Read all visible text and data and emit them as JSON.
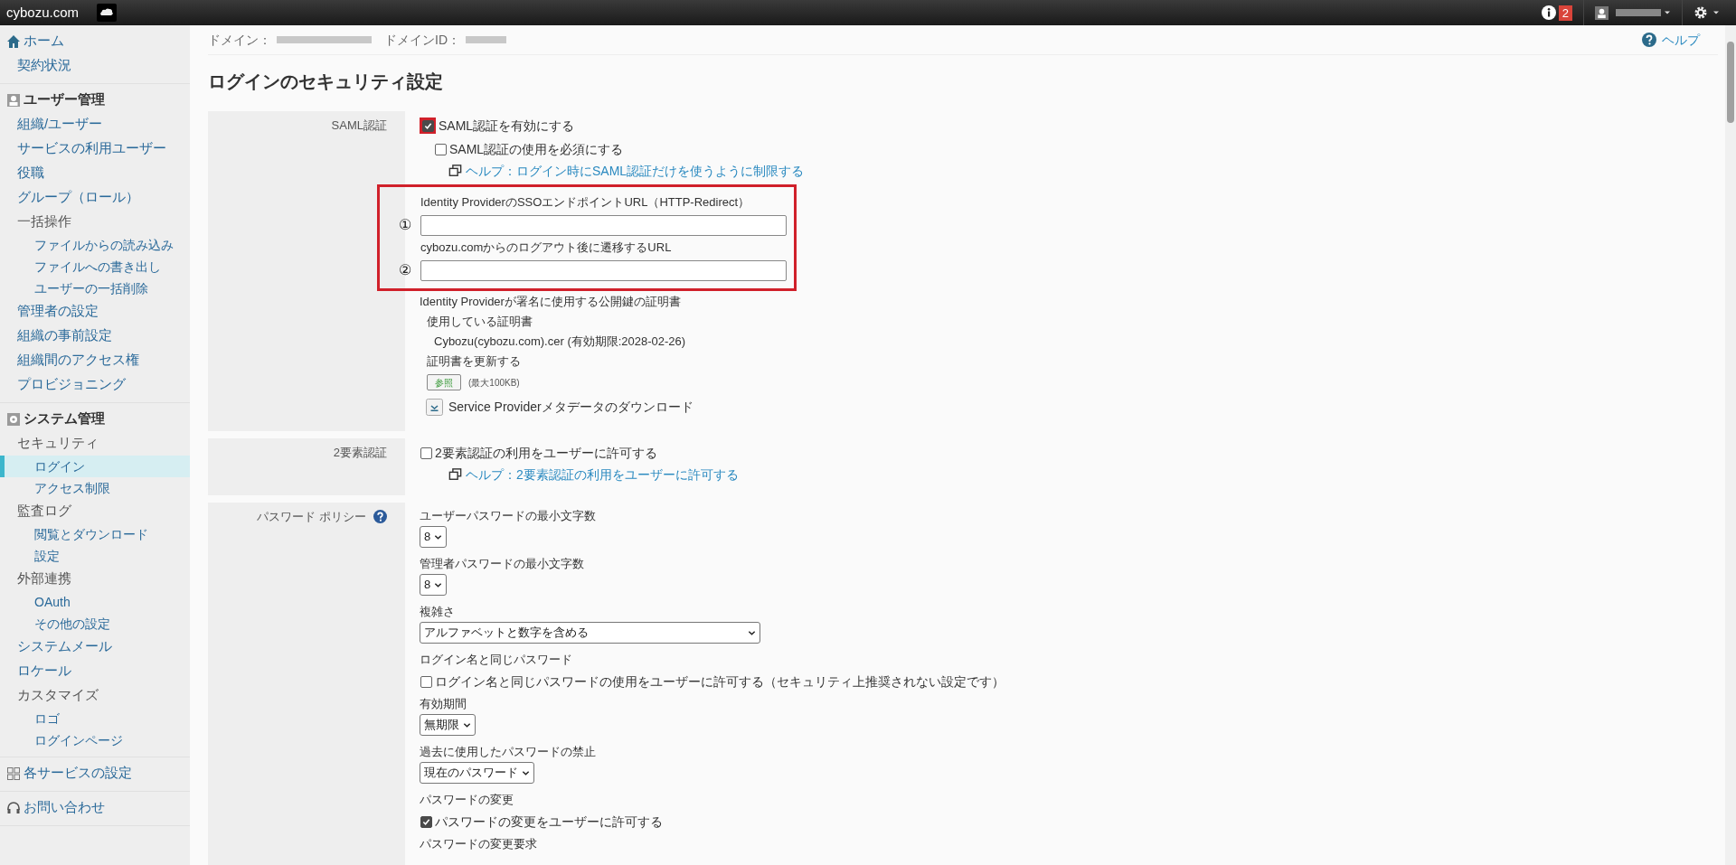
{
  "topbar": {
    "brand": "cybozu.com",
    "notifications": "2"
  },
  "sidebar": [
    {
      "kind": "home",
      "label": "ホーム",
      "children": [
        {
          "label": "契約状況",
          "selected": false
        }
      ]
    },
    {
      "kind": "user",
      "label": "ユーザー管理",
      "children": [
        {
          "label": "組織/ユーザー",
          "selected": false
        },
        {
          "label": "サービスの利用ユーザー",
          "selected": false
        },
        {
          "label": "役職",
          "selected": false
        },
        {
          "label": "グループ（ロール）",
          "selected": false
        },
        {
          "label": "一括操作",
          "selected": false,
          "children": [
            {
              "label": "ファイルからの読み込み",
              "selected": false
            },
            {
              "label": "ファイルへの書き出し",
              "selected": false
            },
            {
              "label": "ユーザーの一括削除",
              "selected": false
            }
          ]
        },
        {
          "label": "管理者の設定",
          "selected": false
        },
        {
          "label": "組織の事前設定",
          "selected": false
        },
        {
          "label": "組織間のアクセス権",
          "selected": false
        },
        {
          "label": "プロビジョニング",
          "selected": false
        }
      ]
    },
    {
      "kind": "gear",
      "label": "システム管理",
      "children": [
        {
          "label": "セキュリティ",
          "selected": false,
          "children": [
            {
              "label": "ログイン",
              "selected": true
            },
            {
              "label": "アクセス制限",
              "selected": false
            }
          ]
        },
        {
          "label": "監査ログ",
          "selected": false,
          "children": [
            {
              "label": "閲覧とダウンロード",
              "selected": false
            },
            {
              "label": "設定",
              "selected": false
            }
          ]
        },
        {
          "label": "外部連携",
          "selected": false,
          "children": [
            {
              "label": "OAuth",
              "selected": false
            },
            {
              "label": "その他の設定",
              "selected": false
            }
          ]
        },
        {
          "label": "システムメール",
          "selected": false
        },
        {
          "label": "ロケール",
          "selected": false
        },
        {
          "label": "カスタマイズ",
          "selected": false,
          "children": [
            {
              "label": "ロゴ",
              "selected": false
            },
            {
              "label": "ログインページ",
              "selected": false
            }
          ]
        }
      ]
    },
    {
      "kind": "grid",
      "label": "各サービスの設定"
    },
    {
      "kind": "headset",
      "label": "お問い合わせ"
    }
  ],
  "header": {
    "domain_label": "ドメイン：",
    "domain_id_label": "ドメインID：",
    "help": "ヘルプ"
  },
  "title": "ログインのセキュリティ設定",
  "sections": [
    {
      "label": "SAML認証",
      "items": [
        {
          "kind": "checkbox",
          "label": "SAML認証を有効にする",
          "checked": true,
          "highlighted": true
        },
        {
          "kind": "subcheckbox",
          "label": "SAML認証の使用を必須にする",
          "checked": false,
          "highlighted": false
        },
        {
          "kind": "help",
          "label": "ヘルプ：ログイン時にSAML認証だけを使うように制限する"
        },
        {
          "kind": "fieldgroup",
          "highlighted": true,
          "fields": [
            {
              "label": "Identity ProviderのSSOエンドポイントURL（HTTP-Redirect）",
              "marker": "①"
            },
            {
              "label": "cybozu.comからのログアウト後に遷移するURL",
              "marker": "②"
            }
          ]
        },
        {
          "kind": "text",
          "label": "Identity Providerが署名に使用する公開鍵の証明書"
        },
        {
          "kind": "subtext",
          "label": "使用している証明書"
        },
        {
          "kind": "subsubtext",
          "label": "Cybozu(cybozu.com).cer (有効期限:2028-02-26)"
        },
        {
          "kind": "subtext",
          "label": "証明書を更新する"
        },
        {
          "kind": "file",
          "label": "参照",
          "note": "(最大100KB)"
        },
        {
          "kind": "download",
          "label": "Service Providerメタデータのダウンロード"
        }
      ]
    },
    {
      "label": "2要素認証",
      "items": [
        {
          "kind": "checkbox",
          "label": "2要素認証の利用をユーザーに許可する",
          "checked": false,
          "highlighted": false
        },
        {
          "kind": "help",
          "label": "ヘルプ：2要素認証の利用をユーザーに許可する"
        }
      ]
    },
    {
      "label": "パスワード ポリシー",
      "help_icon": true,
      "items": [
        {
          "kind": "text",
          "label": "ユーザーパスワードの最小文字数"
        },
        {
          "kind": "select",
          "value": "8",
          "wide": false
        },
        {
          "kind": "text",
          "label": "管理者パスワードの最小文字数"
        },
        {
          "kind": "select",
          "value": "8",
          "wide": false
        },
        {
          "kind": "text",
          "label": "複雑さ"
        },
        {
          "kind": "select",
          "value": "アルファベットと数字を含める",
          "wide": true
        },
        {
          "kind": "text",
          "label": "ログイン名と同じパスワード"
        },
        {
          "kind": "checkbox",
          "label": "ログイン名と同じパスワードの使用をユーザーに許可する（セキュリティ上推奨されない設定です）",
          "checked": false,
          "highlighted": false
        },
        {
          "kind": "text",
          "label": "有効期間"
        },
        {
          "kind": "select",
          "value": "無期限",
          "wide": false
        },
        {
          "kind": "text",
          "label": "過去に使用したパスワードの禁止"
        },
        {
          "kind": "select",
          "value": "現在のパスワード",
          "wide": false
        },
        {
          "kind": "text",
          "label": "パスワードの変更"
        },
        {
          "kind": "checkbox",
          "label": "パスワードの変更をユーザーに許可する",
          "checked": true,
          "highlighted": false
        },
        {
          "kind": "text",
          "label": "パスワードの変更要求"
        }
      ]
    }
  ]
}
